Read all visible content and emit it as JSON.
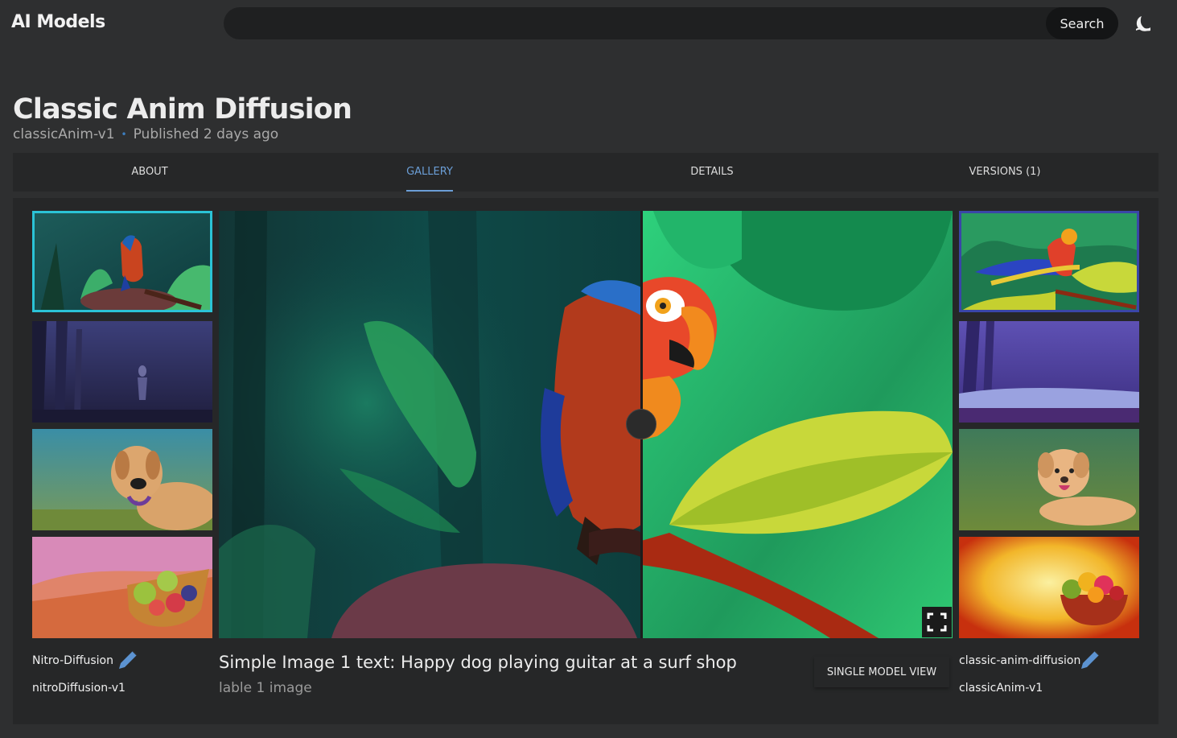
{
  "header": {
    "logo": "AI Models",
    "search_placeholder": "",
    "search_button": "Search",
    "theme_icon": "moon-icon"
  },
  "model": {
    "title": "Classic Anim Diffusion",
    "version": "classicAnim-v1",
    "published": "Published 2 days ago"
  },
  "tabs": [
    {
      "label": "ABOUT",
      "active": false
    },
    {
      "label": "GALLERY",
      "active": true
    },
    {
      "label": "DETAILS",
      "active": false
    },
    {
      "label": "VERSIONS (1)",
      "active": false
    }
  ],
  "gallery": {
    "left_model": {
      "name": "Nitro-Diffusion",
      "version": "nitroDiffusion-v1"
    },
    "right_model": {
      "name": "classic-anim-diffusion",
      "version": "classicAnim-v1"
    },
    "left_thumbs": [
      "parrot",
      "forest-figure",
      "dog",
      "fruit-bowl"
    ],
    "right_thumbs": [
      "parrot",
      "forest-lake",
      "dog",
      "fruit-bowl"
    ],
    "selected_index": 0,
    "caption": "Simple Image 1 text: Happy dog playing guitar at a surf shop",
    "caption_sub": "lable 1 image",
    "single_view_button": "SINGLE MODEL VIEW",
    "icons": {
      "edit": "pencil-icon",
      "fullscreen": "fullscreen-icon"
    }
  },
  "colors": {
    "background": "#2e2f30",
    "panel": "#262728",
    "accent": "#6b9ed6",
    "selected_left": "#2bc3d6",
    "selected_right": "#3a46a8",
    "edit_icon": "#5c93d1"
  }
}
